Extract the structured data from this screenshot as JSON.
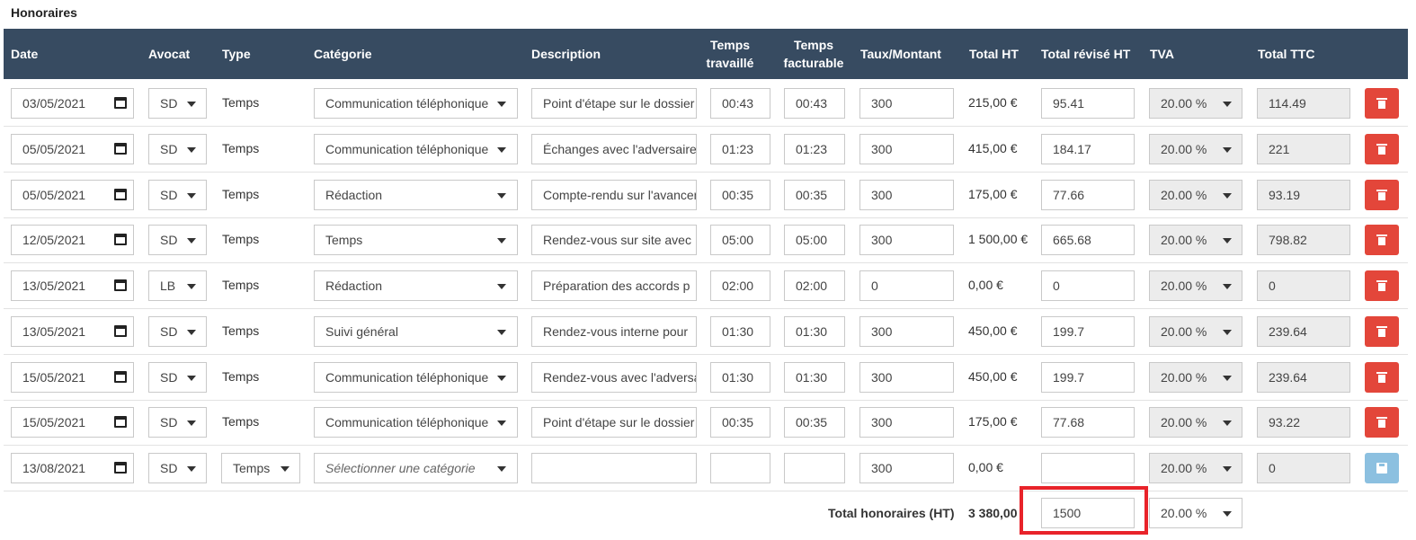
{
  "section_title": "Honoraires",
  "headers": {
    "date": "Date",
    "avocat": "Avocat",
    "type": "Type",
    "categorie": "Catégorie",
    "description": "Description",
    "temps_travaille": "Temps travaillé",
    "temps_facturable": "Temps facturable",
    "taux_montant": "Taux/Montant",
    "total_ht": "Total HT",
    "total_revise_ht": "Total révisé HT",
    "tva": "TVA",
    "total_ttc": "Total TTC"
  },
  "rows": [
    {
      "date": "03/05/2021",
      "avocat": "SD",
      "type": "Temps",
      "categorie": "Communication téléphonique",
      "description": "Point d'étape sur le dossier",
      "temps_travaille": "00:43",
      "temps_facturable": "00:43",
      "taux": "300",
      "total_ht": "215,00 €",
      "total_revise": "95.41",
      "tva": "20.00 %",
      "total_ttc": "114.49"
    },
    {
      "date": "05/05/2021",
      "avocat": "SD",
      "type": "Temps",
      "categorie": "Communication téléphonique",
      "description": "Échanges avec l'adversaire",
      "temps_travaille": "01:23",
      "temps_facturable": "01:23",
      "taux": "300",
      "total_ht": "415,00 €",
      "total_revise": "184.17",
      "tva": "20.00 %",
      "total_ttc": "221"
    },
    {
      "date": "05/05/2021",
      "avocat": "SD",
      "type": "Temps",
      "categorie": "Rédaction",
      "description": "Compte-rendu sur l'avancement",
      "temps_travaille": "00:35",
      "temps_facturable": "00:35",
      "taux": "300",
      "total_ht": "175,00 €",
      "total_revise": "77.66",
      "tva": "20.00 %",
      "total_ttc": "93.19"
    },
    {
      "date": "12/05/2021",
      "avocat": "SD",
      "type": "Temps",
      "categorie": "Temps",
      "description": "Rendez-vous sur site avec",
      "temps_travaille": "05:00",
      "temps_facturable": "05:00",
      "taux": "300",
      "total_ht": "1 500,00 €",
      "total_revise": "665.68",
      "tva": "20.00 %",
      "total_ttc": "798.82"
    },
    {
      "date": "13/05/2021",
      "avocat": "LB",
      "type": "Temps",
      "categorie": "Rédaction",
      "description": "Préparation des accords p",
      "temps_travaille": "02:00",
      "temps_facturable": "02:00",
      "taux": "0",
      "total_ht": "0,00 €",
      "total_revise": "0",
      "tva": "20.00 %",
      "total_ttc": "0"
    },
    {
      "date": "13/05/2021",
      "avocat": "SD",
      "type": "Temps",
      "categorie": "Suivi général",
      "description": "Rendez-vous interne pour",
      "temps_travaille": "01:30",
      "temps_facturable": "01:30",
      "taux": "300",
      "total_ht": "450,00 €",
      "total_revise": "199.7",
      "tva": "20.00 %",
      "total_ttc": "239.64"
    },
    {
      "date": "15/05/2021",
      "avocat": "SD",
      "type": "Temps",
      "categorie": "Communication téléphonique",
      "description": "Rendez-vous avec l'adversaire",
      "temps_travaille": "01:30",
      "temps_facturable": "01:30",
      "taux": "300",
      "total_ht": "450,00 €",
      "total_revise": "199.7",
      "tva": "20.00 %",
      "total_ttc": "239.64"
    },
    {
      "date": "15/05/2021",
      "avocat": "SD",
      "type": "Temps",
      "categorie": "Communication téléphonique",
      "description": "Point d'étape sur le dossier",
      "temps_travaille": "00:35",
      "temps_facturable": "00:35",
      "taux": "300",
      "total_ht": "175,00 €",
      "total_revise": "77.68",
      "tva": "20.00 %",
      "total_ttc": "93.22"
    }
  ],
  "new_row": {
    "date": "13/08/2021",
    "avocat": "SD",
    "type": "Temps",
    "categorie_placeholder": "Sélectionner une catégorie",
    "description": "",
    "temps_travaille": "",
    "temps_facturable": "",
    "taux": "300",
    "total_ht": "0,00 €",
    "total_revise": "",
    "tva": "20.00 %",
    "total_ttc": "0"
  },
  "totals": {
    "label": "Total honoraires (HT)",
    "total_ht": "3 380,00",
    "total_revise": "1500",
    "tva": "20.00 %"
  },
  "colors": {
    "header_bg": "#374b61",
    "delete_button": "#e3463a",
    "save_button": "#8cc0e0",
    "highlight": "#e8232a"
  },
  "icons": {
    "date": "calendar-icon",
    "delete": "trash-icon",
    "save": "floppy-disk-icon",
    "dropdown": "chevron-down-icon"
  }
}
